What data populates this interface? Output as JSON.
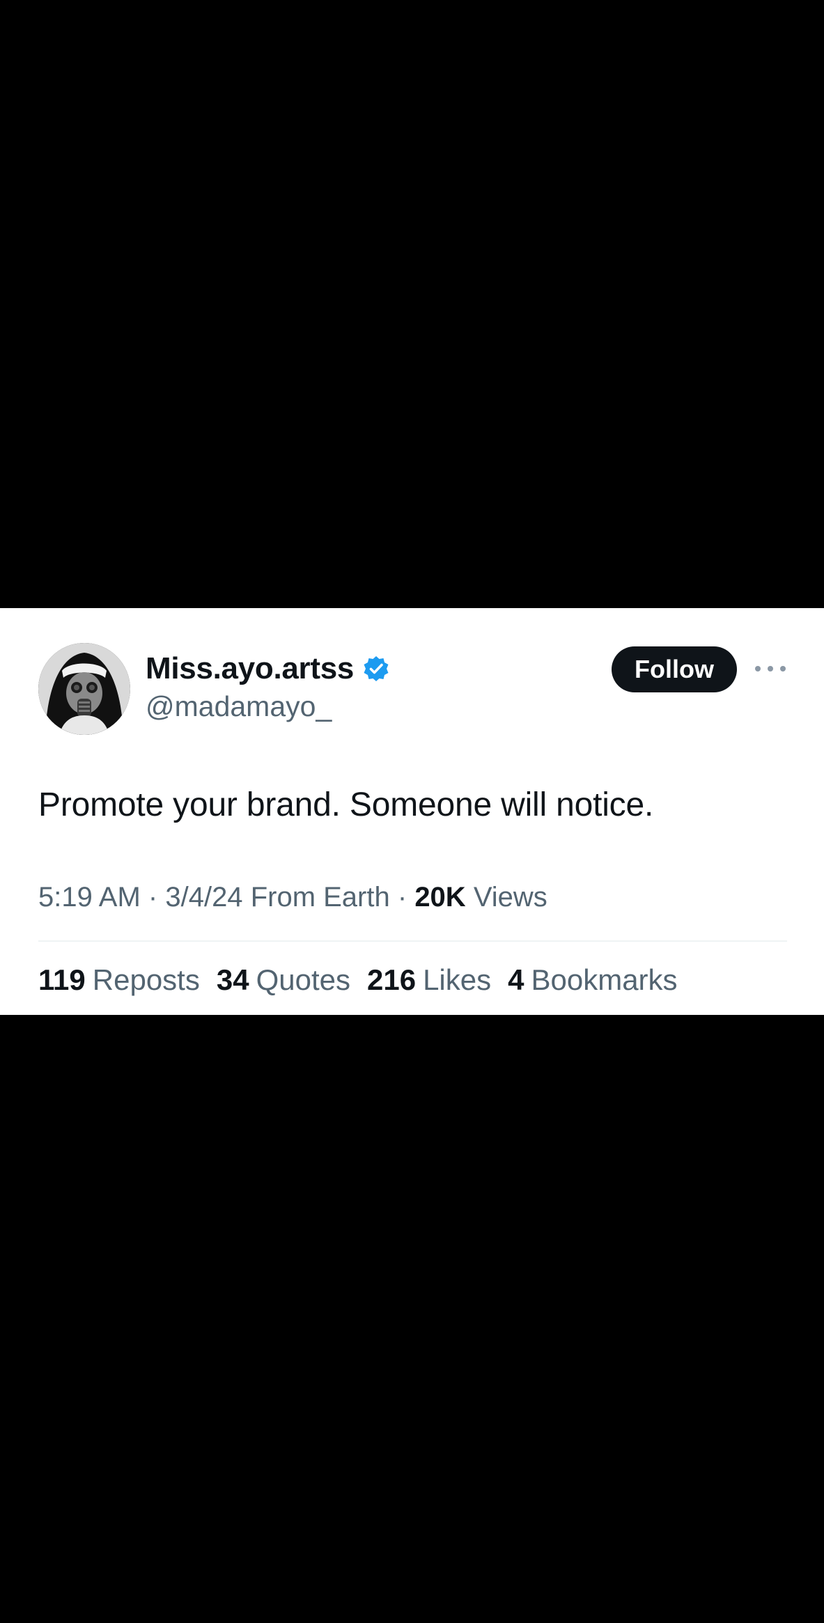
{
  "user": {
    "display_name": "Miss.ayo.artss",
    "handle": "@madamayo_",
    "verified": true,
    "avatar_icon": "gas-mask-avatar"
  },
  "actions": {
    "follow_label": "Follow",
    "more_icon": "ellipsis-icon"
  },
  "tweet": {
    "text": "Promote your brand. Someone will notice.",
    "time": "5:19 AM",
    "separator": "·",
    "date": "3/4/24",
    "location": "From Earth",
    "views_count": "20K",
    "views_label": "Views"
  },
  "stats": [
    {
      "count": "119",
      "label": "Reposts"
    },
    {
      "count": "34",
      "label": "Quotes"
    },
    {
      "count": "216",
      "label": "Likes"
    },
    {
      "count": "4",
      "label": "Bookmarks"
    }
  ],
  "colors": {
    "background": "#000000",
    "card": "#ffffff",
    "primary_text": "#0f1419",
    "secondary_text": "#536471",
    "verified_blue": "#1d9bf0"
  }
}
